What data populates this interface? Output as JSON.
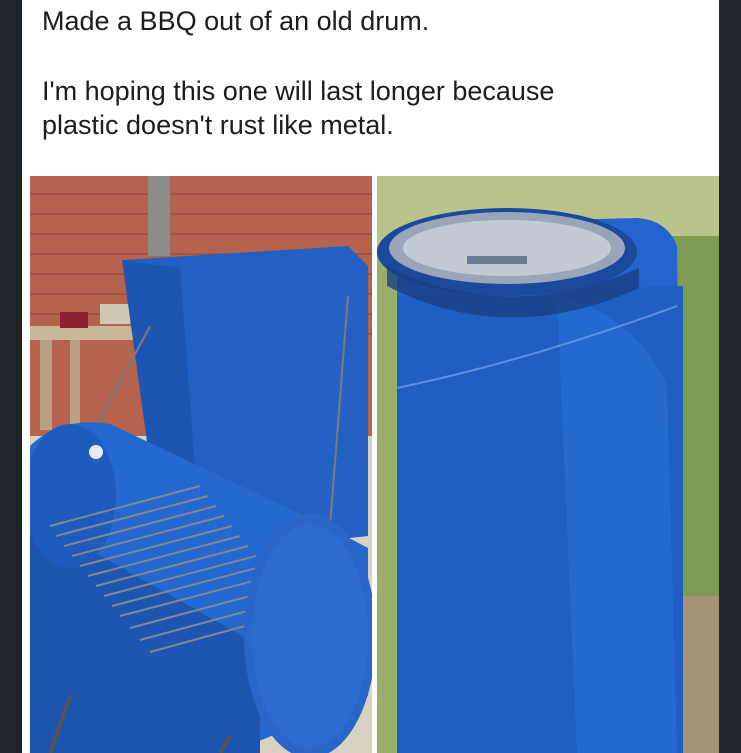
{
  "post": {
    "line1": "Made a BBQ out of an old drum.",
    "line2": "I'm hoping this one will last longer because",
    "line3": "plastic doesn't rust like metal."
  },
  "photos": {
    "left": {
      "subject": "bbq-grill-from-blue-drum"
    },
    "right": {
      "subject": "blue-plastic-drum"
    }
  },
  "colors": {
    "background": "#1f252a",
    "post_bg": "#ffffff",
    "text": "#1c1c1c",
    "drum_blue": "#1f5fc4",
    "brick": "#b5634e"
  }
}
